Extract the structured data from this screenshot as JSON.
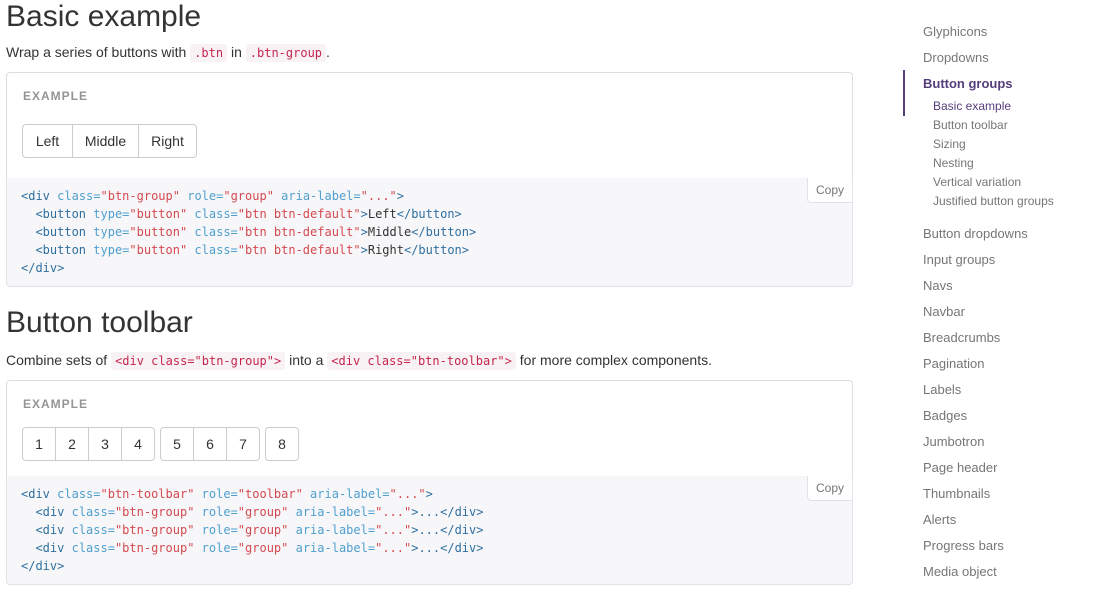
{
  "basic": {
    "title": "Basic example",
    "desc_pre": "Wrap a series of buttons with ",
    "desc_code1": ".btn",
    "desc_mid": " in ",
    "desc_code2": ".btn-group",
    "desc_post": ".",
    "example_label": "EXAMPLE",
    "buttons": [
      "Left",
      "Middle",
      "Right"
    ],
    "copy_label": "Copy",
    "code": {
      "l1_tag": "<div",
      "l1_attr1": "class=",
      "l1_val1": "\"btn-group\"",
      "l1_attr2": "role=",
      "l1_val2": "\"group\"",
      "l1_attr3": "aria-label=",
      "l1_val3": "\"...\"",
      "l1_close": ">",
      "btn_open": "<button",
      "btn_attr1": "type=",
      "btn_val1": "\"button\"",
      "btn_attr2": "class=",
      "btn_val2": "\"btn btn-default\"",
      "btn_gt": ">",
      "btn_close": "</button>",
      "end": "</div>"
    }
  },
  "toolbar": {
    "title": "Button toolbar",
    "desc_pre": "Combine sets of ",
    "desc_code1": "<div class=\"btn-group\">",
    "desc_mid": " into a ",
    "desc_code2": "<div class=\"btn-toolbar\">",
    "desc_post": " for more complex components.",
    "example_label": "EXAMPLE",
    "groups": [
      [
        "1",
        "2",
        "3",
        "4"
      ],
      [
        "5",
        "6",
        "7"
      ],
      [
        "8"
      ]
    ],
    "copy_label": "Copy",
    "code": {
      "l1_tag": "<div",
      "l1_attr1": "class=",
      "l1_val1": "\"btn-toolbar\"",
      "l1_attr2": "role=",
      "l1_val2": "\"toolbar\"",
      "l1_attr3": "aria-label=",
      "l1_val3": "\"...\"",
      "l1_close": ">",
      "g_open": "<div",
      "g_attr1": "class=",
      "g_val1": "\"btn-group\"",
      "g_attr2": "role=",
      "g_val2": "\"group\"",
      "g_attr3": "aria-label=",
      "g_val3": "\"...\"",
      "g_close": ">...</div>",
      "end": "</div>"
    }
  },
  "sidebar": {
    "items_before": [
      "Glyphicons",
      "Dropdowns"
    ],
    "active": "Button groups",
    "sub_items": [
      "Basic example",
      "Button toolbar",
      "Sizing",
      "Nesting",
      "Vertical variation",
      "Justified button groups"
    ],
    "items_after": [
      "Button dropdowns",
      "Input groups",
      "Navs",
      "Navbar",
      "Breadcrumbs",
      "Pagination",
      "Labels",
      "Badges",
      "Jumbotron",
      "Page header",
      "Thumbnails",
      "Alerts",
      "Progress bars",
      "Media object"
    ]
  },
  "colors": {
    "accent": "#563d7c",
    "code_red": "#c7254e",
    "muted": "#767676"
  }
}
